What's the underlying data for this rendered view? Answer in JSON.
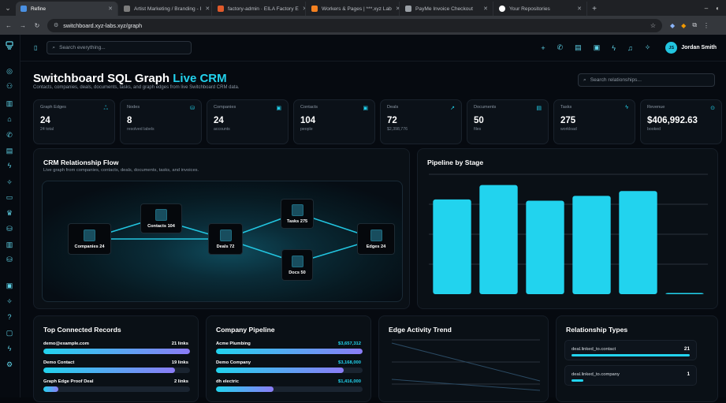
{
  "browser": {
    "tabs": [
      {
        "title": "Refine",
        "active": true,
        "color": "#4a90e2"
      },
      {
        "title": "Artist Marketing / Branding - I",
        "active": false,
        "color": "#7c7c7c"
      },
      {
        "title": "factory-admin · EILA Factory E",
        "active": false,
        "color": "#e05a2b"
      },
      {
        "title": "Workers & Pages | ***.xyz Lab",
        "active": false,
        "color": "#f48120"
      },
      {
        "title": "PayMe Invoice Checkout",
        "active": false,
        "color": "#9aa0a6"
      },
      {
        "title": "Your Repositories",
        "active": false,
        "color": "#ffffff"
      }
    ],
    "url": "switchboard.xyz-labs.xyz/graph"
  },
  "topbar": {
    "search_placeholder": "Search everything...",
    "user_initials": "JS",
    "user_name": "Jordan Smith"
  },
  "header": {
    "title": "Switchboard SQL Graph",
    "title_accent": "Live CRM",
    "subtitle": "Contacts, companies, deals, documents, tasks, and graph edges from live Switchboard CRM data.",
    "relationship_search_placeholder": "Search relationships..."
  },
  "stats": [
    {
      "label": "Graph Edges",
      "value": "24",
      "sub": "24 total",
      "icon": "share-nodes-icon"
    },
    {
      "label": "Nodes",
      "value": "8",
      "sub": "resolved labels",
      "icon": "database-icon"
    },
    {
      "label": "Companies",
      "value": "24",
      "sub": "accounts",
      "icon": "building-icon"
    },
    {
      "label": "Contacts",
      "value": "104",
      "sub": "people",
      "icon": "contact-card-icon"
    },
    {
      "label": "Deals",
      "value": "72",
      "sub": "$2,398,776",
      "icon": "trending-up-icon"
    },
    {
      "label": "Documents",
      "value": "50",
      "sub": "files",
      "icon": "document-icon"
    },
    {
      "label": "Tasks",
      "value": "275",
      "sub": "workload",
      "icon": "activity-icon"
    },
    {
      "label": "Revenue",
      "value": "$406,992.63",
      "sub": "booked",
      "icon": "check-circle-icon"
    }
  ],
  "flow": {
    "title": "CRM Relationship Flow",
    "subtitle": "Live graph from companies, contacts, deals, documents, tasks, and invoices.",
    "nodes": {
      "companies": "Companies 24",
      "contacts": "Contacts 104",
      "deals": "Deals 72",
      "tasks": "Tasks 275",
      "docs": "Docs 50",
      "edges": "Edges 24"
    }
  },
  "pipeline_stage": {
    "title": "Pipeline by Stage"
  },
  "chart_data": {
    "type": "bar",
    "title": "Pipeline by Stage",
    "categories": [
      "",
      "",
      "",
      "",
      "",
      ""
    ],
    "values": [
      0.79,
      0.91,
      0.78,
      0.82,
      0.86,
      0.01
    ],
    "grid": true,
    "legend": "none"
  },
  "top_connected": {
    "title": "Top Connected Records",
    "rows": [
      {
        "label": "demo@example.com",
        "count": "21 links",
        "fraction": 1.0
      },
      {
        "label": "Demo Contact",
        "count": "19 links",
        "fraction": 0.9
      },
      {
        "label": "Graph Edge Proof Deal",
        "count": "2 links",
        "fraction": 0.1
      }
    ]
  },
  "company_pipeline": {
    "title": "Company Pipeline",
    "rows": [
      {
        "label": "Acme Plumbing",
        "amount": "$3,657,312",
        "fraction": 1.0
      },
      {
        "label": "Demo Company",
        "amount": "$3,168,000",
        "fraction": 0.87
      },
      {
        "label": "dh electric",
        "amount": "$1,416,000",
        "fraction": 0.39
      }
    ]
  },
  "edge_activity": {
    "title": "Edge Activity Trend"
  },
  "relationship_types": {
    "title": "Relationship Types",
    "rows": [
      {
        "label": "deal.linked_to.contact",
        "count": "21",
        "fraction": 1.0
      },
      {
        "label": "deal.linked_to.company",
        "count": "1",
        "fraction": 0.1
      }
    ]
  },
  "colors": {
    "accent": "#22d3ee",
    "background": "#060a10",
    "card": "#0a1016"
  }
}
